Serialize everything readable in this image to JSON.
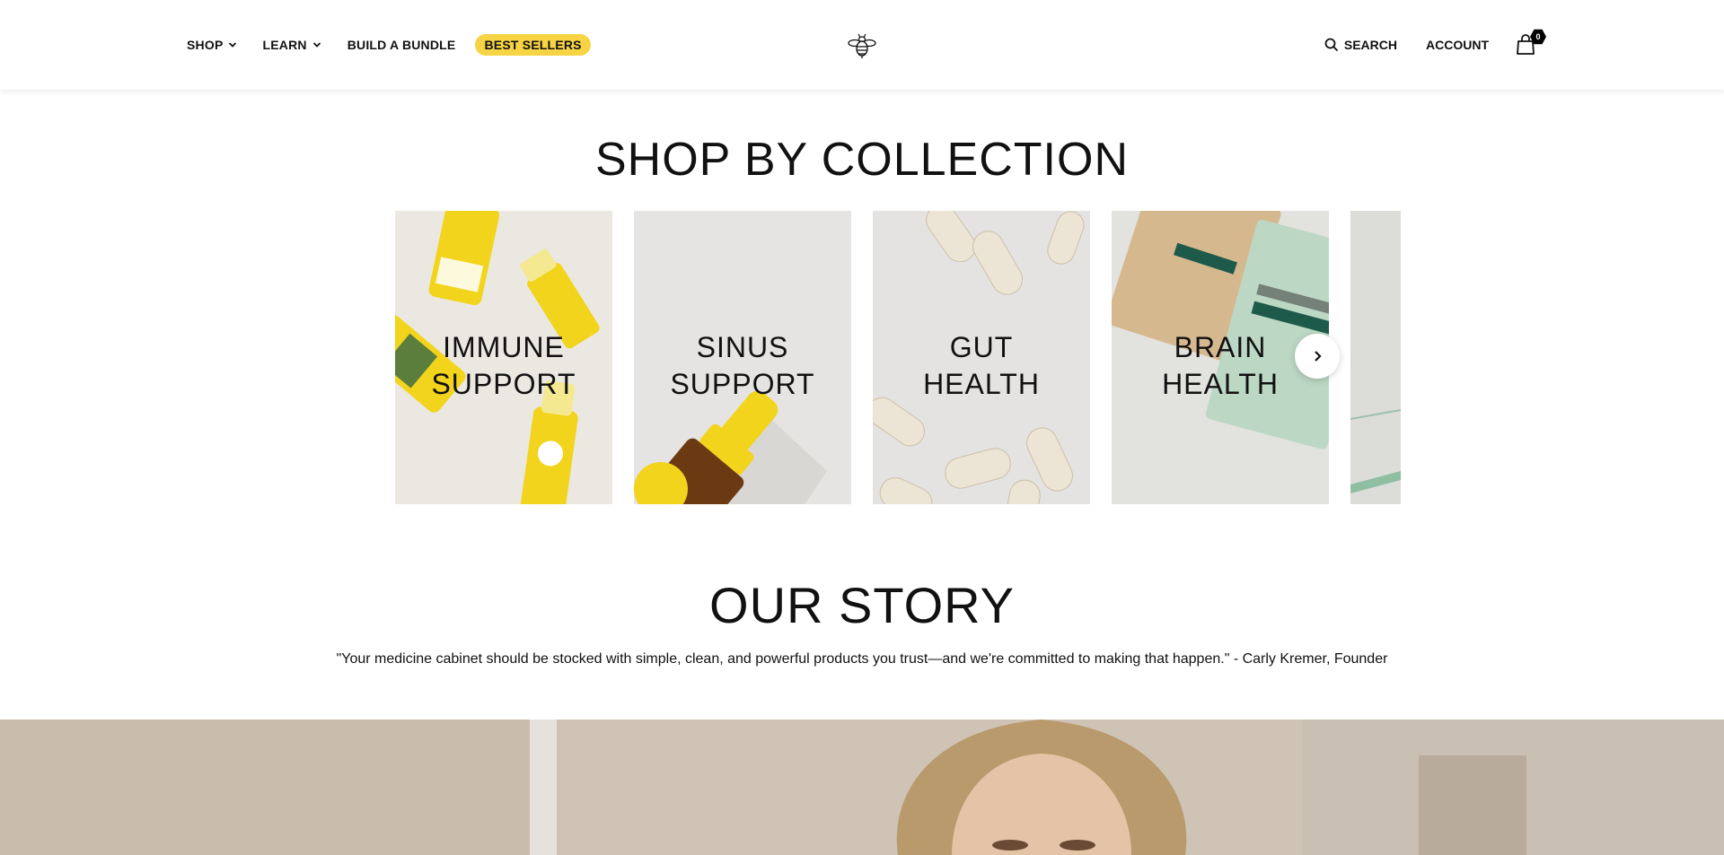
{
  "header": {
    "nav_left": {
      "shop": "SHOP",
      "learn": "LEARN",
      "bundle": "BUILD A BUNDLE",
      "best_sellers": "BEST SELLERS"
    },
    "logo_icon": "bee-icon",
    "search_label": "SEARCH",
    "account_label": "ACCOUNT",
    "cart_count": "0"
  },
  "collections": {
    "title": "SHOP BY COLLECTION",
    "cards": [
      {
        "line1": "IMMUNE",
        "line2": "SUPPORT"
      },
      {
        "line1": "SINUS",
        "line2": "SUPPORT"
      },
      {
        "line1": "GUT",
        "line2": "HEALTH"
      },
      {
        "line1": "BRAIN",
        "line2": "HEALTH"
      }
    ]
  },
  "story": {
    "title": "OUR STORY",
    "quote": "\"Your medicine cabinet should be stocked with simple, clean, and powerful products you trust—and we're committed to making that happen.\" - Carly Kremer, Founder"
  },
  "colors": {
    "accent_yellow": "#f7d443",
    "text": "#111111",
    "background": "#ffffff"
  }
}
